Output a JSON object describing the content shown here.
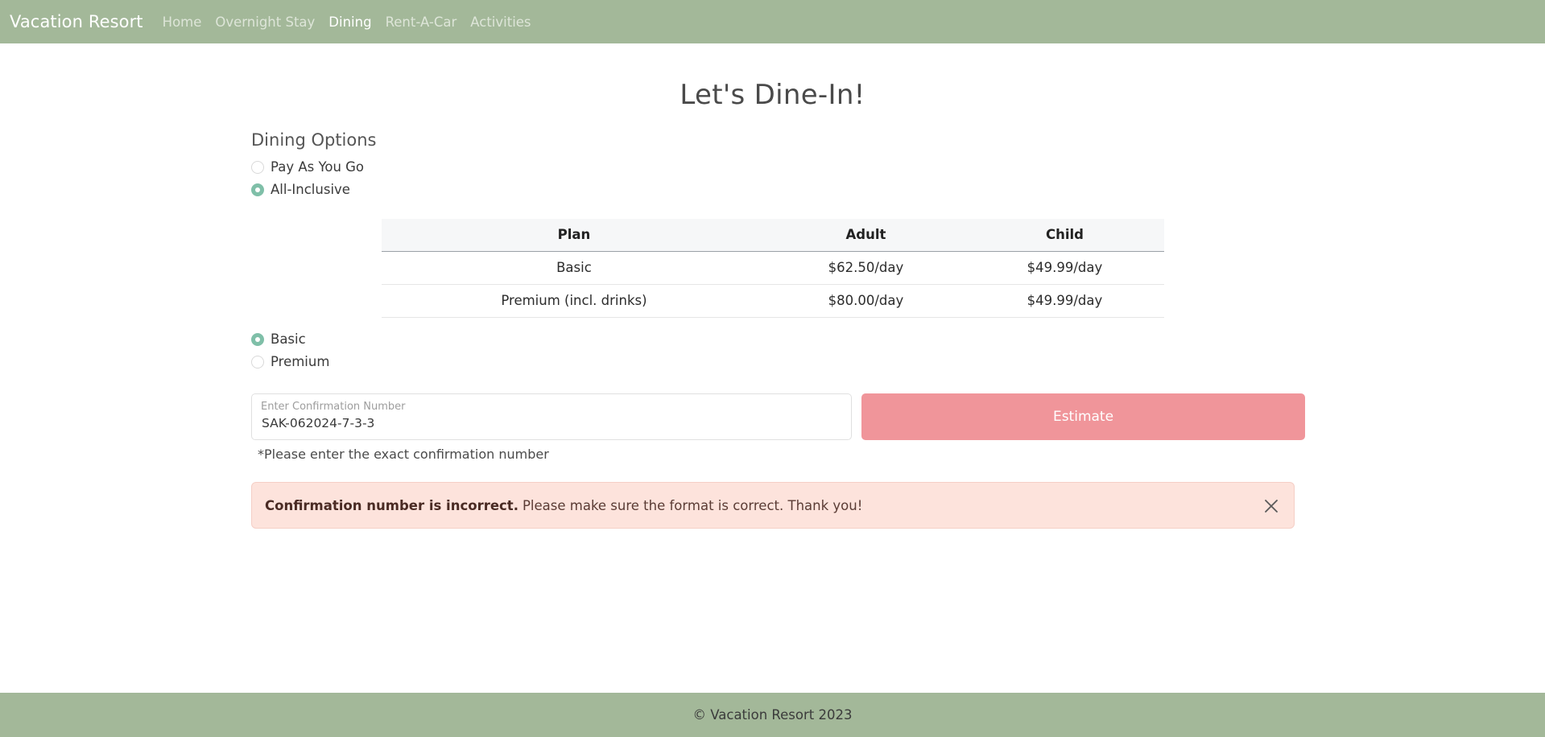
{
  "navbar": {
    "brand": "Vacation Resort",
    "links": [
      {
        "label": "Home",
        "active": false
      },
      {
        "label": "Overnight Stay",
        "active": false
      },
      {
        "label": "Dining",
        "active": true
      },
      {
        "label": "Rent-A-Car",
        "active": false
      },
      {
        "label": "Activities",
        "active": false
      }
    ]
  },
  "main": {
    "title": "Let's Dine-In!",
    "section_title": "Dining Options",
    "dining_options": [
      {
        "label": "Pay As You Go",
        "checked": false
      },
      {
        "label": "All-Inclusive",
        "checked": true
      }
    ],
    "table": {
      "headers": [
        "Plan",
        "Adult",
        "Child"
      ],
      "rows": [
        [
          "Basic",
          "$62.50/day",
          "$49.99/day"
        ],
        [
          "Premium (incl. drinks)",
          "$80.00/day",
          "$49.99/day"
        ]
      ]
    },
    "plan_options": [
      {
        "label": "Basic",
        "checked": true
      },
      {
        "label": "Premium",
        "checked": false
      }
    ],
    "confirmation": {
      "label": "Enter Confirmation Number",
      "value": "SAK-062024-7-3-3",
      "hint": "*Please enter the exact confirmation number"
    },
    "estimate_label": "Estimate",
    "alert": {
      "strong": "Confirmation number is incorrect.",
      "message": "Please make sure the format is correct. Thank you!"
    }
  },
  "footer": {
    "text": "© Vacation Resort 2023"
  },
  "colors": {
    "nav_bg": "#a3b899",
    "accent": "#7fbfa8",
    "button": "#f0959a",
    "alert_bg": "#fde3dc"
  }
}
